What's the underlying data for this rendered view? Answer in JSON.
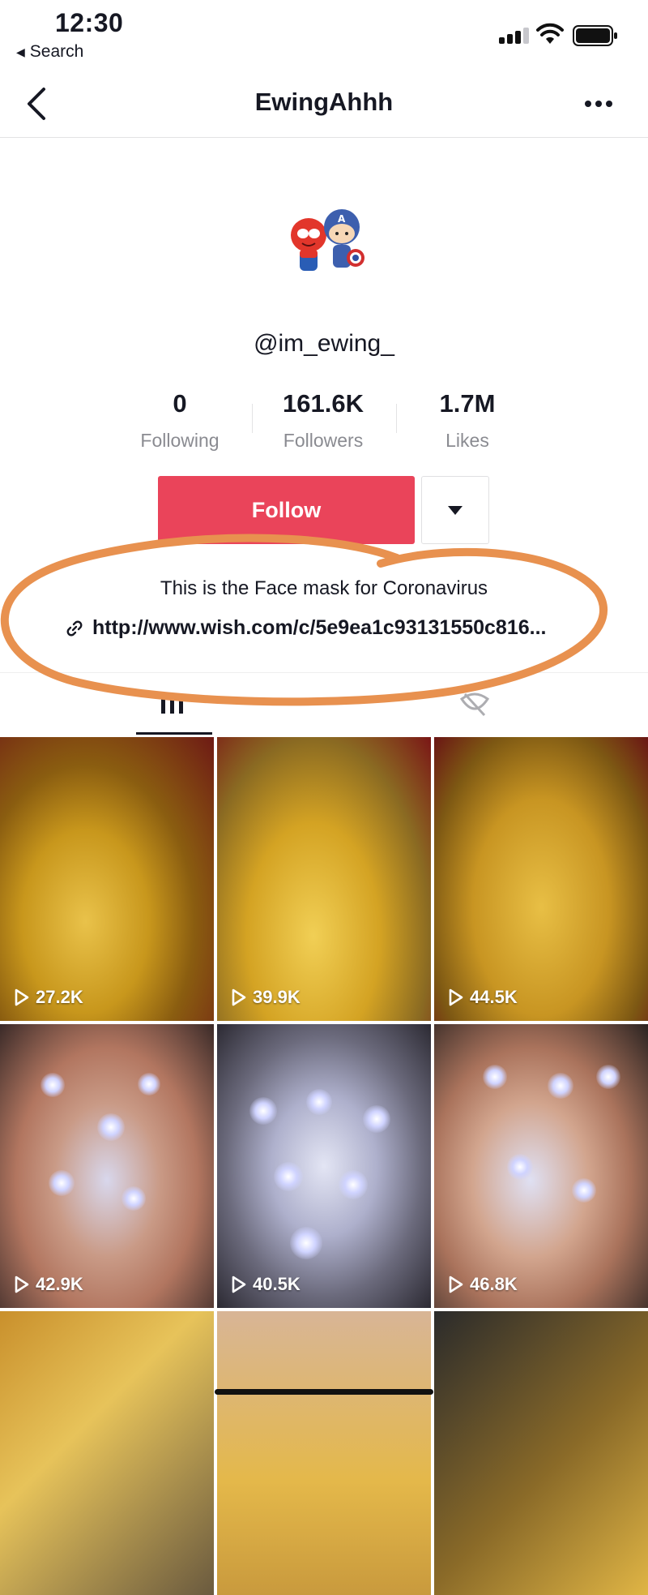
{
  "status_bar": {
    "time": "12:30",
    "back_app": "Search"
  },
  "nav": {
    "title": "EwingAhhh"
  },
  "profile": {
    "username": "@im_ewing_",
    "stats": [
      {
        "value": "0",
        "label": "Following"
      },
      {
        "value": "161.6K",
        "label": "Followers"
      },
      {
        "value": "1.7M",
        "label": "Likes"
      }
    ],
    "follow_label": "Follow",
    "bio": "This is the Face mask for Coronavirus",
    "link": "http://www.wish.com/c/5e9ea1c93131550c816..."
  },
  "videos": [
    {
      "views": "27.2K"
    },
    {
      "views": "39.9K"
    },
    {
      "views": "44.5K"
    },
    {
      "views": "42.9K"
    },
    {
      "views": "40.5K"
    },
    {
      "views": "46.8K"
    }
  ],
  "colors": {
    "follow": "#ea445a",
    "annotation": "#e8914f"
  }
}
